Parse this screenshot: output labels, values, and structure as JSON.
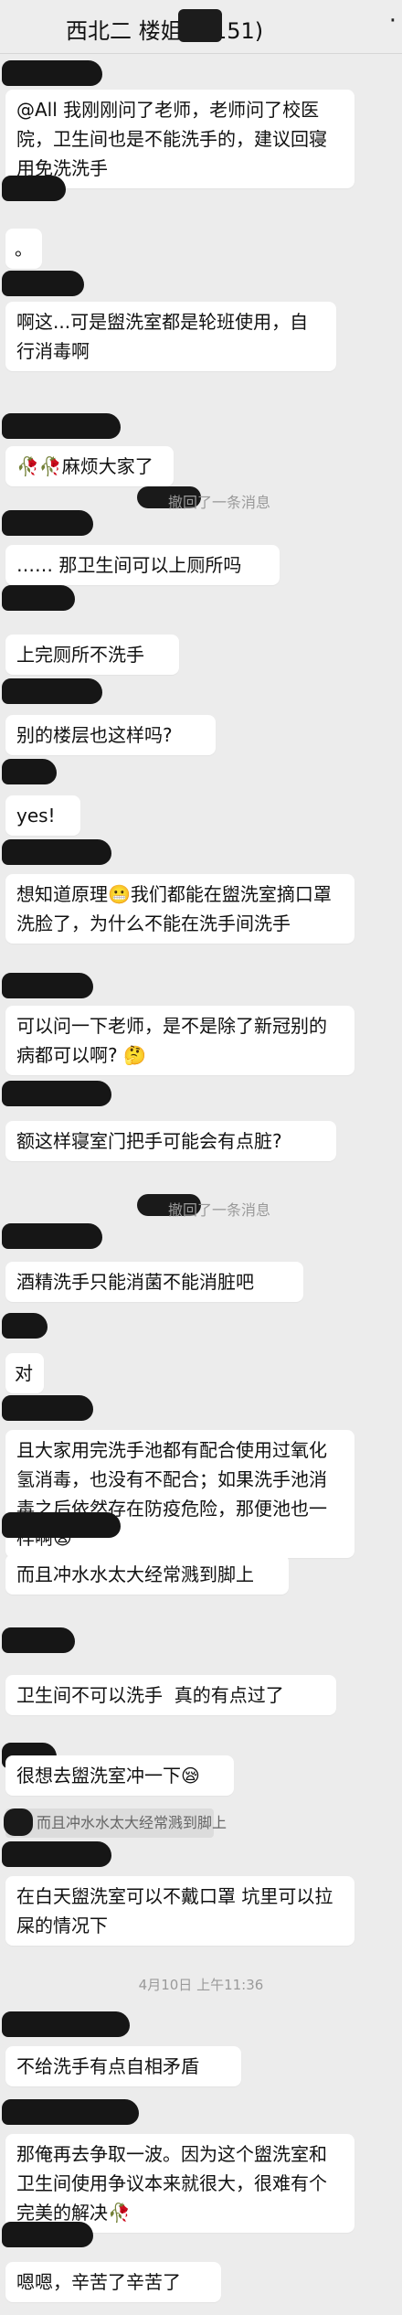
{
  "header": {
    "title": "西北二  楼姐妹(151)",
    "mute_icon": "bell-mute-icon",
    "more": "·"
  },
  "messages": [
    {
      "text": "@All 我刚刚问了老师，老师问了校医院，卫生间也是不能洗手的，建议回寝用免洗洗手"
    },
    {
      "text": "。"
    },
    {
      "text": "啊这...可是盥洗室都是轮班使用，自行消毒啊"
    },
    {
      "text": "🥀🥀麻烦大家了"
    },
    {
      "recall": "撤回了一条消息"
    },
    {
      "text": "…… 那卫生间可以上厕所吗"
    },
    {
      "text": "上完厕所不洗手"
    },
    {
      "text": "别的楼层也这样吗?"
    },
    {
      "text": "yes!"
    },
    {
      "text": "想知道原理😬我们都能在盥洗室摘口罩洗脸了，为什么不能在洗手间洗手"
    },
    {
      "text": "可以问一下老师，是不是除了新冠别的病都可以啊? 🤔"
    },
    {
      "text": "额这样寝室门把手可能会有点脏?"
    },
    {
      "recall": "撤回了一条消息"
    },
    {
      "text": "酒精洗手只能消菌不能消脏吧"
    },
    {
      "text": "对"
    },
    {
      "text": "且大家用完洗手池都有配合使用过氧化氢消毒，也没有不配合；如果洗手池消毒之后依然存在防疫危险，那便池也一样啊😪"
    },
    {
      "text": "而且冲水水太大经常溅到脚上"
    },
    {
      "text": "卫生间不可以洗手  真的有点过了"
    },
    {
      "text": "很想去盥洗室冲一下😪"
    },
    {
      "quote": "而且冲水水太大经常溅到脚上"
    },
    {
      "text": "在白天盥洗室可以不戴口罩 坑里可以拉屎的情况下"
    },
    {
      "time": "4月10日 上午11:36"
    },
    {
      "text": "不给洗手有点自相矛盾"
    },
    {
      "text": "那俺再去争取一波。因为这个盥洗室和卫生间使用争议本来就很大，很难有个完美的解决🥀"
    },
    {
      "text": "嗯嗯，辛苦了辛苦了"
    }
  ]
}
